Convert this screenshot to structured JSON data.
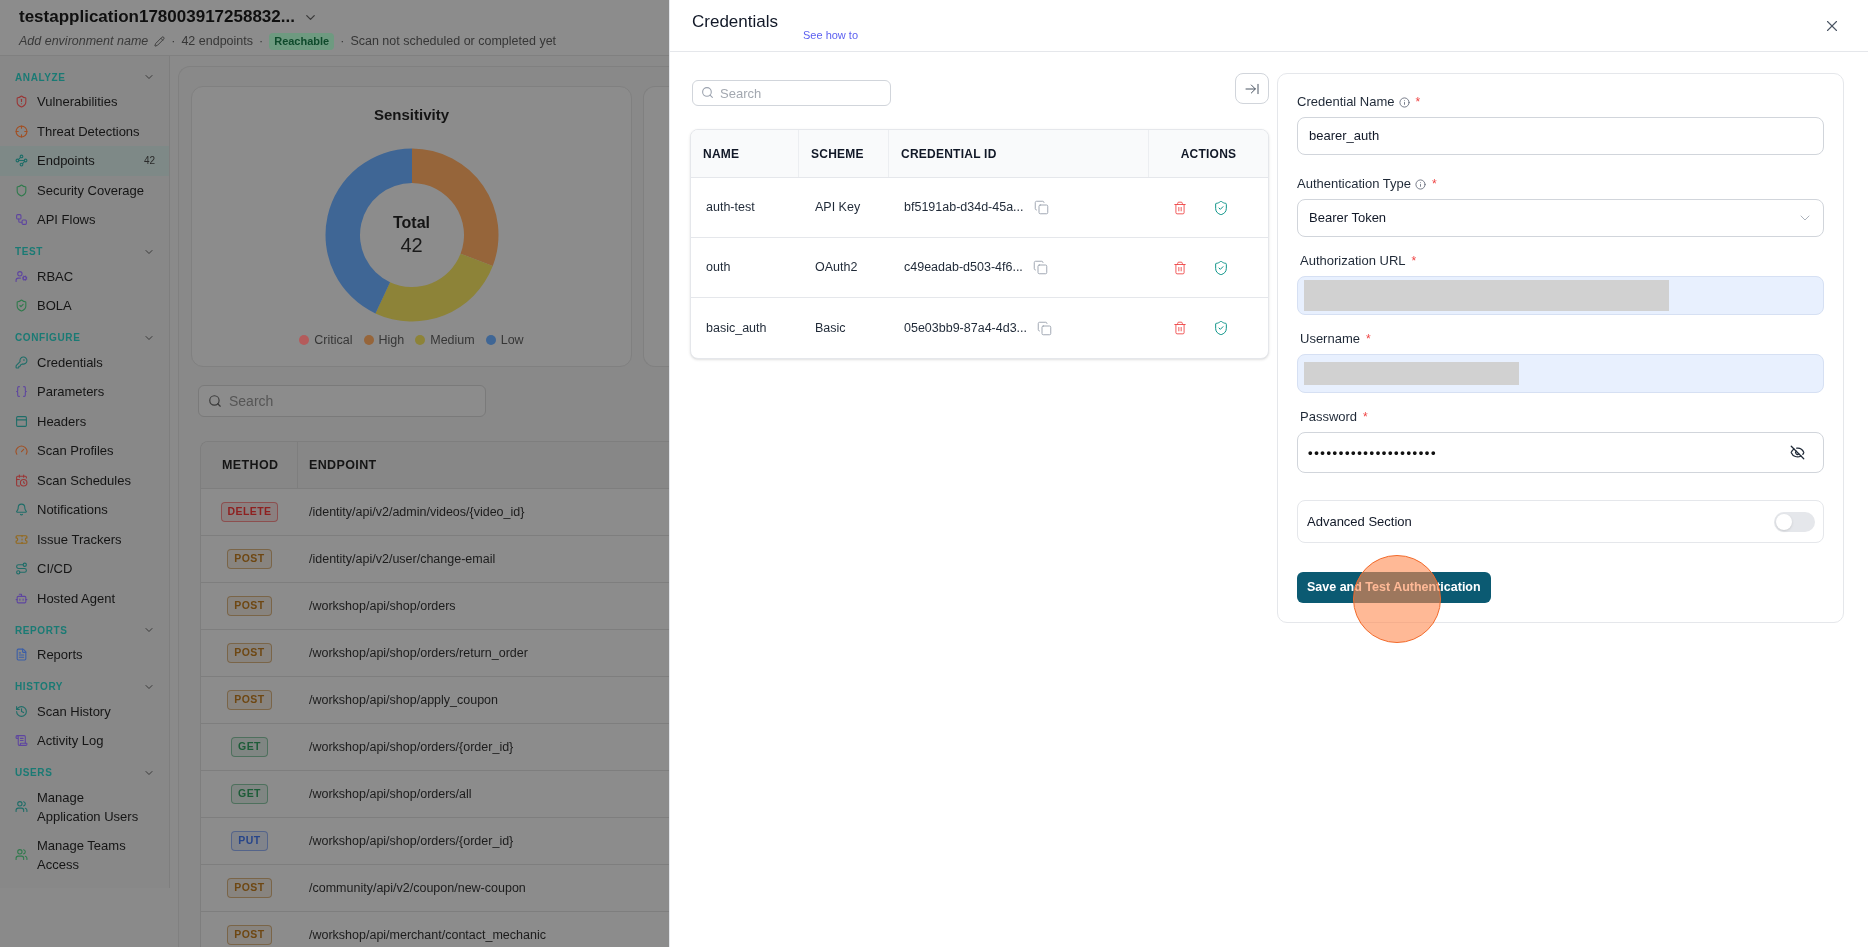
{
  "app_header": {
    "title": "testapplication178003917258832...",
    "meta": [
      {
        "kind": "placeholder",
        "text": "Add environment name"
      },
      {
        "kind": "separator",
        "text": "·"
      },
      {
        "kind": "text",
        "text": "42 endpoints"
      },
      {
        "kind": "separator",
        "text": "·"
      },
      {
        "kind": "badge",
        "text": "Reachable"
      },
      {
        "kind": "separator",
        "text": "·"
      },
      {
        "kind": "text",
        "text": "Scan not scheduled or completed yet"
      }
    ]
  },
  "sidebar": {
    "sections": [
      {
        "title": "ANALYZE",
        "expanded": true,
        "items": [
          {
            "label": "Vulnerabilities",
            "selected": false
          },
          {
            "label": "Threat Detections",
            "selected": false
          },
          {
            "label": "Endpoints",
            "selected": true,
            "count": "42"
          },
          {
            "label": "Security Coverage",
            "selected": false
          },
          {
            "label": "API Flows",
            "selected": false
          }
        ]
      },
      {
        "title": "TEST",
        "expanded": true,
        "items": [
          {
            "label": "RBAC",
            "selected": false
          },
          {
            "label": "BOLA",
            "selected": false
          }
        ]
      },
      {
        "title": "CONFIGURE",
        "expanded": true,
        "items": [
          {
            "label": "Credentials",
            "selected": false
          },
          {
            "label": "Parameters",
            "selected": false
          },
          {
            "label": "Headers",
            "selected": false
          },
          {
            "label": "Scan Profiles",
            "selected": false
          },
          {
            "label": "Scan Schedules",
            "selected": false
          },
          {
            "label": "Notifications",
            "selected": false
          },
          {
            "label": "Issue Trackers",
            "selected": false
          },
          {
            "label": "CI/CD",
            "selected": false
          },
          {
            "label": "Hosted Agent",
            "selected": false
          }
        ]
      },
      {
        "title": "REPORTS",
        "expanded": true,
        "items": [
          {
            "label": "Reports",
            "selected": false
          }
        ]
      },
      {
        "title": "HISTORY",
        "expanded": true,
        "items": [
          {
            "label": "Scan History",
            "selected": false
          },
          {
            "label": "Activity Log",
            "selected": false
          }
        ]
      },
      {
        "title": "USERS",
        "expanded": true,
        "items": [
          {
            "label": "Manage Application Users",
            "selected": false
          },
          {
            "label": "Manage Teams Access",
            "selected": false
          }
        ]
      }
    ]
  },
  "main": {
    "sensitivity_card": {
      "title": "Sensitivity",
      "total_label": "Total",
      "total_value": "42",
      "legend": [
        {
          "label": "Critical",
          "color": "#b45b5b"
        },
        {
          "label": "High",
          "color": "#96653a"
        },
        {
          "label": "Medium",
          "color": "#8d8338"
        },
        {
          "label": "Low",
          "color": "#3f6695"
        }
      ]
    },
    "search": {
      "placeholder": "Search"
    },
    "endpoints_table": {
      "columns": [
        "METHOD",
        "ENDPOINT"
      ],
      "rows": [
        {
          "method": "DELETE",
          "path": "/identity/api/v2/admin/videos/{video_id}",
          "color": "#8e2020"
        },
        {
          "method": "POST",
          "path": "/identity/api/v2/user/change-email",
          "color": "#6e4712"
        },
        {
          "method": "POST",
          "path": "/workshop/api/shop/orders",
          "color": "#6e4712"
        },
        {
          "method": "POST",
          "path": "/workshop/api/shop/orders/return_order",
          "color": "#6e4712"
        },
        {
          "method": "POST",
          "path": "/workshop/api/shop/apply_coupon",
          "color": "#6e4712"
        },
        {
          "method": "GET",
          "path": "/workshop/api/shop/orders/{order_id}",
          "color": "#1d5c38"
        },
        {
          "method": "GET",
          "path": "/workshop/api/shop/orders/all",
          "color": "#1d5c38"
        },
        {
          "method": "PUT",
          "path": "/workshop/api/shop/orders/{order_id}",
          "color": "#27458a"
        },
        {
          "method": "POST",
          "path": "/community/api/v2/coupon/new-coupon",
          "color": "#6e4712"
        },
        {
          "method": "POST",
          "path": "/workshop/api/merchant/contact_mechanic",
          "color": "#6e4712"
        }
      ]
    }
  },
  "credentials_drawer": {
    "title": "Credentials",
    "help_link": "See how to",
    "search": {
      "placeholder": "Search"
    },
    "table": {
      "columns": [
        "NAME",
        "SCHEME",
        "CREDENTIAL ID",
        "ACTIONS"
      ],
      "rows": [
        {
          "name": "auth-test",
          "scheme": "API Key",
          "credential_id": "bf5191ab-d34d-45a..."
        },
        {
          "name": "outh",
          "scheme": "OAuth2",
          "credential_id": "c49eadab-d503-4f6..."
        },
        {
          "name": "basic_auth",
          "scheme": "Basic",
          "credential_id": "05e03bb9-87a4-4d3..."
        }
      ]
    },
    "form": {
      "fields": [
        {
          "kind": "text",
          "label": "Credential Name",
          "info_icon": true,
          "required_mark": "*",
          "autofilled": false,
          "value": "bearer_auth"
        },
        {
          "kind": "select",
          "label": "Authentication Type",
          "info_icon": true,
          "required_mark": "*",
          "autofilled": false,
          "value": "Bearer Token"
        },
        {
          "kind": "redacted",
          "label": "Authorization URL",
          "info_icon": false,
          "required_mark": "*",
          "autofilled": true
        },
        {
          "kind": "redacted",
          "label": "Username",
          "info_icon": false,
          "required_mark": "*",
          "autofilled": true
        },
        {
          "kind": "password",
          "label": "Password",
          "info_icon": false,
          "required_mark": "*",
          "autofilled": false,
          "value": "•••••••••••••••••••••"
        }
      ],
      "advanced_section": {
        "label": "Advanced Section",
        "on": false
      },
      "submit_button": "Save and Test Authentication"
    }
  }
}
